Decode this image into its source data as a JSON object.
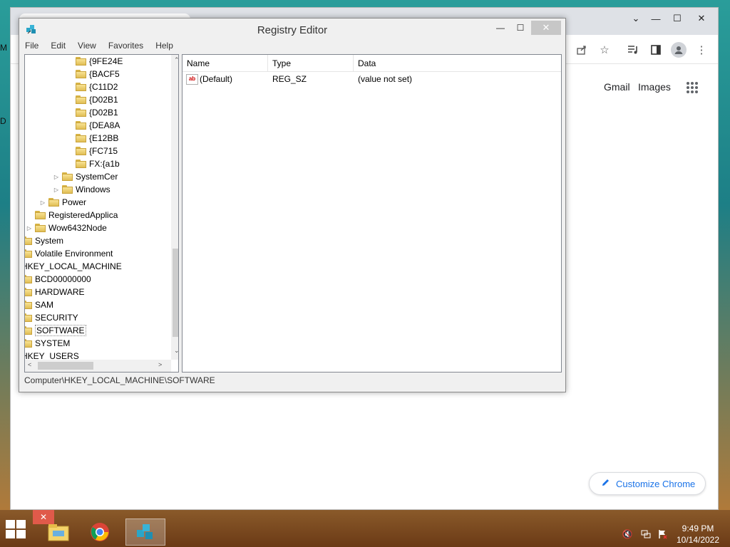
{
  "desktop": {
    "letters": [
      "M",
      "D"
    ]
  },
  "chrome": {
    "window_controls": {
      "minimize": "—",
      "maximize": "☐",
      "close": "✕",
      "tabsearch": "⌄"
    },
    "header_links": {
      "gmail": "Gmail",
      "images": "Images"
    },
    "customize_label": "Customize Chrome"
  },
  "regedit": {
    "title": "Registry Editor",
    "menu": [
      "File",
      "Edit",
      "View",
      "Favorites",
      "Help"
    ],
    "tree": [
      {
        "label": "{9FE24E",
        "indent": 8,
        "expander": ""
      },
      {
        "label": "{BACF5",
        "indent": 8,
        "expander": ""
      },
      {
        "label": "{C11D2",
        "indent": 8,
        "expander": ""
      },
      {
        "label": "{D02B1",
        "indent": 8,
        "expander": ""
      },
      {
        "label": "{D02B1",
        "indent": 8,
        "expander": ""
      },
      {
        "label": "{DEA8A",
        "indent": 8,
        "expander": ""
      },
      {
        "label": "{E12BB",
        "indent": 8,
        "expander": ""
      },
      {
        "label": "{FC715",
        "indent": 8,
        "expander": ""
      },
      {
        "label": "FX:{a1b",
        "indent": 8,
        "expander": ""
      },
      {
        "label": "SystemCer",
        "indent": 7,
        "expander": "▷"
      },
      {
        "label": "Windows",
        "indent": 7,
        "expander": "▷"
      },
      {
        "label": "Power",
        "indent": 6,
        "expander": "▷"
      },
      {
        "label": "RegisteredApplica",
        "indent": 5,
        "expander": ""
      },
      {
        "label": "Wow6432Node",
        "indent": 5,
        "expander": "▷"
      },
      {
        "label": "System",
        "indent": 4,
        "expander": "▷"
      },
      {
        "label": "Volatile Environment",
        "indent": 4,
        "expander": "▷"
      },
      {
        "label": "HKEY_LOCAL_MACHINE",
        "indent": 3,
        "expander": "◢"
      },
      {
        "label": "BCD00000000",
        "indent": 4,
        "expander": "▷"
      },
      {
        "label": "HARDWARE",
        "indent": 4,
        "expander": "▷"
      },
      {
        "label": "SAM",
        "indent": 4,
        "expander": "▷"
      },
      {
        "label": "SECURITY",
        "indent": 4,
        "expander": ""
      },
      {
        "label": "SOFTWARE",
        "indent": 4,
        "expander": "▷",
        "selected": true
      },
      {
        "label": "SYSTEM",
        "indent": 4,
        "expander": "▷"
      },
      {
        "label": "HKEY_USERS",
        "indent": 3,
        "expander": "▷"
      }
    ],
    "columns": [
      "Name",
      "Type",
      "Data"
    ],
    "values": [
      {
        "icon": "ab",
        "name": "(Default)",
        "type": "REG_SZ",
        "data": "(value not set)"
      }
    ],
    "status_path": "Computer\\HKEY_LOCAL_MACHINE\\SOFTWARE"
  },
  "taskbar": {
    "time": "9:49 PM",
    "date": "10/14/2022",
    "peek_close": "✕"
  },
  "colors": {
    "chrome_blue": "#1a73e8",
    "close_red": "#e05a4a",
    "taskbar": "#7a4a20"
  }
}
